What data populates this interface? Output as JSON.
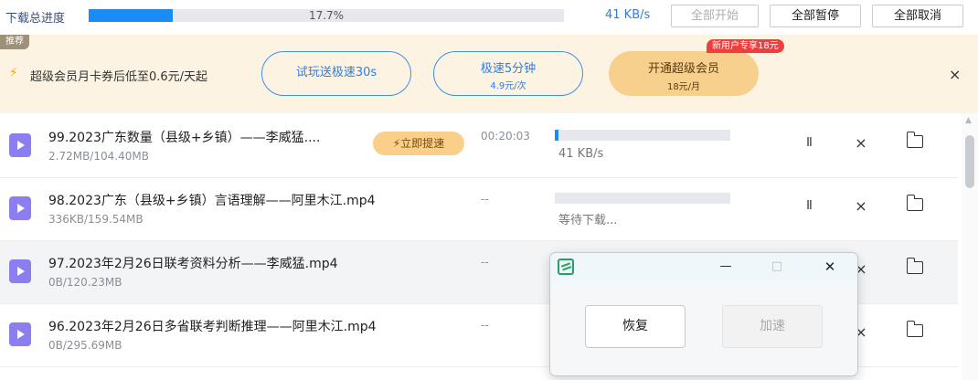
{
  "header": {
    "title": "下载总进度",
    "progress_percent": 17.7,
    "progress_label": "17.7%",
    "speed": "41 KB/s",
    "start_all": "全部开始",
    "pause_all": "全部暂停",
    "cancel_all": "全部取消"
  },
  "promo": {
    "tag": "推荐",
    "text": "超级会员月卡券后低至0.6元/天起",
    "trial_button": "试玩送极速30s",
    "speed_button": {
      "line1": "极速5分钟",
      "line2": "4.9元/次"
    },
    "vip_button": {
      "line1": "开通超级会员",
      "line2": "18元/月",
      "badge": "新用户专享18元"
    },
    "close_icon": "×"
  },
  "downloads": [
    {
      "name": "99.2023广东数量（县级+乡镇）——李威猛....",
      "size": "2.72MB/104.40MB",
      "boost_label": "立即提速",
      "eta": "00:20:03",
      "progress": 0.02,
      "status": "41 KB/s",
      "pause_icon": "II",
      "cancel_icon": "×"
    },
    {
      "name": "98.2023广东（县级+乡镇）言语理解——阿里木江.mp4",
      "size": "336KB/159.54MB",
      "eta": "--",
      "progress": 0.0,
      "status": "等待下载...",
      "pause_icon": "II",
      "cancel_icon": "×"
    },
    {
      "name": "97.2023年2月26日联考资料分析——李威猛.mp4",
      "size": "0B/120.23MB",
      "eta": "--",
      "cancel_icon": "×"
    },
    {
      "name": "96.2023年2月26日多省联考判断推理——阿里木江.mp4",
      "size": "0B/295.69MB",
      "eta": "--",
      "cancel_icon": "×"
    }
  ],
  "dialog": {
    "minimize": "—",
    "maximize": "□",
    "close": "✕",
    "resume_button": "恢复",
    "accelerate_button": "加速"
  },
  "colors": {
    "accent": "#1a8cf3",
    "promo_bg": "#fdf3e2",
    "vip_gold": "#f7d08d",
    "badge_red": "#ee3e3e",
    "file_icon": "#8b7ff0"
  }
}
